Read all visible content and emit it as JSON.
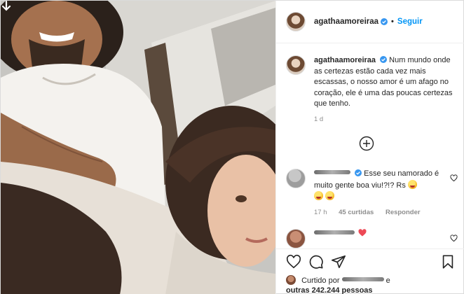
{
  "post": {
    "author": "agathaamoreiraa",
    "header_separator": "•",
    "follow_label": "Seguir"
  },
  "caption": {
    "author": "agathaamoreiraa",
    "text": "Num mundo onde as certezas estão cada vez mais escassas, o nosso amor é um afago no coração, ele é uma das poucas certezas que tenho.",
    "age": "1 d"
  },
  "comments": [
    {
      "text": "Esse seu namorado é muito gente boa viu!?!? Rs",
      "age": "17 h",
      "likes": "45 curtidas",
      "reply_label": "Responder"
    },
    {
      "text": ""
    }
  ],
  "likes": {
    "prefix": "Curtido por",
    "suffix": "e",
    "others": "outras 242.244 pessoas"
  },
  "icons": {
    "carousel": "arrow-down-icon",
    "verified": "verified-badge-icon",
    "more_comments": "plus-circle-icon",
    "like": "heart-icon",
    "comment": "comment-icon",
    "share": "share-icon",
    "save": "bookmark-icon"
  },
  "colors": {
    "accent": "#0095f6",
    "verified": "#3897f0",
    "muted_text": "#8e8e8e",
    "heart_red": "#ed4956"
  }
}
